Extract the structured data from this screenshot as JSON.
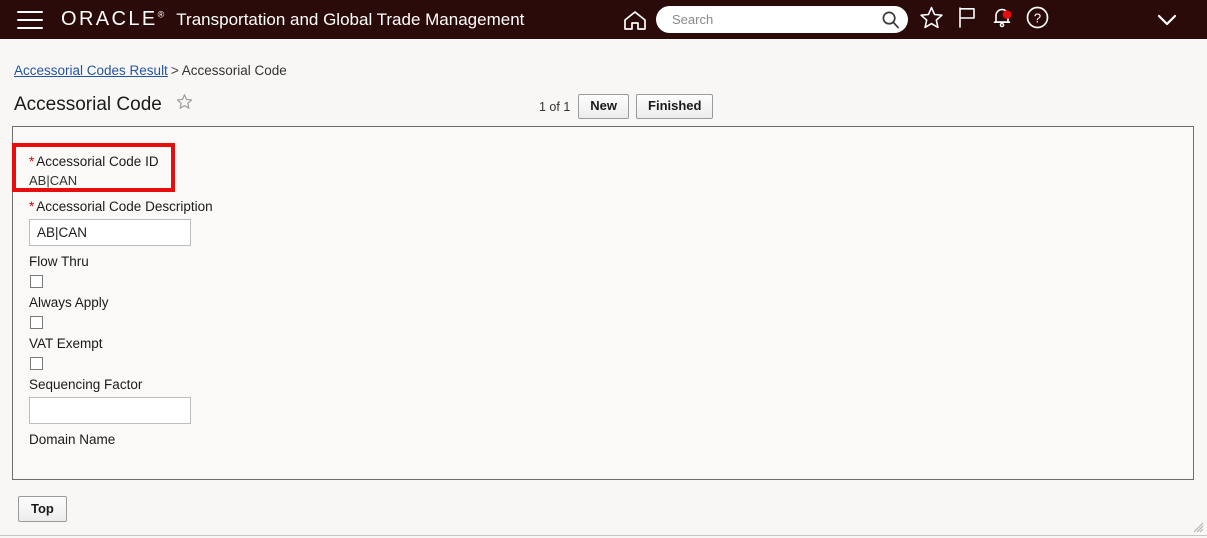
{
  "header": {
    "menu_icon": "hamburger-menu-icon",
    "brand": "ORACLE",
    "brand_mark": "®",
    "app_title": "Transportation and Global Trade Management",
    "home_icon": "home-icon",
    "search": {
      "placeholder": "Search",
      "value": "",
      "icon": "search-icon"
    },
    "icons": [
      {
        "name": "favorites-star-icon",
        "glyph": "star"
      },
      {
        "name": "bookmark-flag-icon",
        "glyph": "flag"
      },
      {
        "name": "notifications-bell-icon",
        "glyph": "bell",
        "badge": true
      },
      {
        "name": "help-question-icon",
        "glyph": "question"
      }
    ],
    "user_menu_icon": "chevron-down-icon",
    "accent_color": "#2b0a0a",
    "badge_color": "#e80c0c"
  },
  "breadcrumb": {
    "parent_label": "Accessorial Codes Result",
    "separator": ">",
    "current_label": "Accessorial Code",
    "link_color": "#24559e"
  },
  "title_bar": {
    "title": "Accessorial Code",
    "favorite_icon": "star-outline-icon",
    "record_count": "1 of 1",
    "new_label": "New",
    "finished_label": "Finished"
  },
  "form": {
    "fields": [
      {
        "name": "accessorial-code-id",
        "label": "Accessorial Code ID",
        "required": true,
        "type": "readonly",
        "value": "AB|CAN",
        "highlighted": true
      },
      {
        "name": "accessorial-code-description",
        "label": "Accessorial Code Description",
        "required": true,
        "type": "text",
        "value": "AB|CAN"
      },
      {
        "name": "flow-thru",
        "label": "Flow Thru",
        "required": false,
        "type": "checkbox",
        "checked": false
      },
      {
        "name": "always-apply",
        "label": "Always Apply",
        "required": false,
        "type": "checkbox",
        "checked": false
      },
      {
        "name": "vat-exempt",
        "label": "VAT Exempt",
        "required": false,
        "type": "checkbox",
        "checked": false
      },
      {
        "name": "sequencing-factor",
        "label": "Sequencing Factor",
        "required": false,
        "type": "text",
        "value": ""
      },
      {
        "name": "domain-name",
        "label": "Domain Name",
        "required": false,
        "type": "label-only",
        "value": ""
      }
    ]
  },
  "footer": {
    "top_label": "Top",
    "resize_grip_icon": "resize-grip-icon"
  },
  "annotation": {
    "highlight_color": "#e80c0c",
    "target_field": "Accessorial Code ID"
  }
}
